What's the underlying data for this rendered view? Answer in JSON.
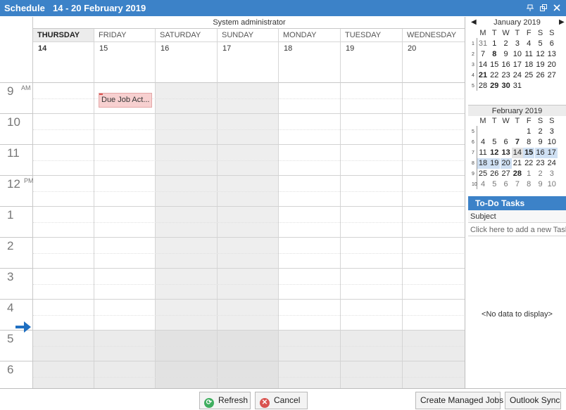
{
  "window": {
    "title": "Schedule",
    "date_range": "14 - 20 February 2019",
    "controls": [
      "pin",
      "restore",
      "close"
    ]
  },
  "resource": "System administrator",
  "days": [
    {
      "name": "THURSDAY",
      "date": "14",
      "today": true
    },
    {
      "name": "FRIDAY",
      "date": "15"
    },
    {
      "name": "SATURDAY",
      "date": "16",
      "weekend": true
    },
    {
      "name": "SUNDAY",
      "date": "17",
      "weekend": true
    },
    {
      "name": "MONDAY",
      "date": "18"
    },
    {
      "name": "TUESDAY",
      "date": "19"
    },
    {
      "name": "WEDNESDAY",
      "date": "20"
    }
  ],
  "hours": [
    {
      "h": "9",
      "ampm": "AM"
    },
    {
      "h": "10",
      "ampm": ""
    },
    {
      "h": "11",
      "ampm": ""
    },
    {
      "h": "12",
      "ampm": "PM"
    },
    {
      "h": "1",
      "ampm": ""
    },
    {
      "h": "2",
      "ampm": ""
    },
    {
      "h": "3",
      "ampm": ""
    },
    {
      "h": "4",
      "ampm": ""
    },
    {
      "h": "5",
      "ampm": ""
    },
    {
      "h": "6",
      "ampm": ""
    }
  ],
  "appointment": {
    "label": "Due Job Act...",
    "day": "FRIDAY",
    "hour": "9 AM"
  },
  "mini_calendars": [
    {
      "title": "January 2019",
      "dow": [
        "M",
        "T",
        "W",
        "T",
        "F",
        "S",
        "S"
      ],
      "weeks": [
        {
          "wk": "1",
          "days": [
            {
              "d": "31",
              "o": true
            },
            {
              "d": "1"
            },
            {
              "d": "2"
            },
            {
              "d": "3"
            },
            {
              "d": "4"
            },
            {
              "d": "5"
            },
            {
              "d": "6"
            }
          ]
        },
        {
          "wk": "2",
          "days": [
            {
              "d": "7"
            },
            {
              "d": "8",
              "b": true
            },
            {
              "d": "9"
            },
            {
              "d": "10"
            },
            {
              "d": "11"
            },
            {
              "d": "12"
            },
            {
              "d": "13"
            }
          ]
        },
        {
          "wk": "3",
          "days": [
            {
              "d": "14"
            },
            {
              "d": "15"
            },
            {
              "d": "16"
            },
            {
              "d": "17"
            },
            {
              "d": "18"
            },
            {
              "d": "19"
            },
            {
              "d": "20"
            }
          ]
        },
        {
          "wk": "4",
          "days": [
            {
              "d": "21",
              "b": true
            },
            {
              "d": "22"
            },
            {
              "d": "23"
            },
            {
              "d": "24"
            },
            {
              "d": "25"
            },
            {
              "d": "26"
            },
            {
              "d": "27"
            }
          ]
        },
        {
          "wk": "5",
          "days": [
            {
              "d": "28"
            },
            {
              "d": "29",
              "b": true
            },
            {
              "d": "30",
              "b": true
            },
            {
              "d": "31"
            }
          ]
        }
      ]
    },
    {
      "title": "February 2019",
      "dow": [
        "M",
        "T",
        "W",
        "T",
        "F",
        "S",
        "S"
      ],
      "weeks": [
        {
          "wk": "5",
          "days": [
            {
              "d": ""
            },
            {
              "d": ""
            },
            {
              "d": ""
            },
            {
              "d": ""
            },
            {
              "d": "1"
            },
            {
              "d": "2"
            },
            {
              "d": "3"
            }
          ]
        },
        {
          "wk": "6",
          "days": [
            {
              "d": "4"
            },
            {
              "d": "5"
            },
            {
              "d": "6"
            },
            {
              "d": "7",
              "b": true
            },
            {
              "d": "8"
            },
            {
              "d": "9"
            },
            {
              "d": "10"
            }
          ]
        },
        {
          "wk": "7",
          "days": [
            {
              "d": "11"
            },
            {
              "d": "12",
              "b": true
            },
            {
              "d": "13",
              "b": true
            },
            {
              "d": "14",
              "t": true
            },
            {
              "d": "15",
              "b": true,
              "s": true
            },
            {
              "d": "16",
              "s": true
            },
            {
              "d": "17",
              "s": true
            }
          ]
        },
        {
          "wk": "8",
          "days": [
            {
              "d": "18",
              "s": true
            },
            {
              "d": "19",
              "s": true
            },
            {
              "d": "20",
              "s": true
            },
            {
              "d": "21"
            },
            {
              "d": "22"
            },
            {
              "d": "23"
            },
            {
              "d": "24"
            }
          ]
        },
        {
          "wk": "9",
          "days": [
            {
              "d": "25"
            },
            {
              "d": "26"
            },
            {
              "d": "27"
            },
            {
              "d": "28",
              "b": true
            },
            {
              "d": "1",
              "o": true
            },
            {
              "d": "2",
              "o": true
            },
            {
              "d": "3",
              "o": true
            }
          ]
        },
        {
          "wk": "10",
          "days": [
            {
              "d": "4",
              "o": true
            },
            {
              "d": "5",
              "o": true
            },
            {
              "d": "6",
              "o": true
            },
            {
              "d": "7",
              "o": true
            },
            {
              "d": "8",
              "o": true
            },
            {
              "d": "9",
              "o": true
            },
            {
              "d": "10",
              "o": true
            }
          ]
        }
      ]
    }
  ],
  "todo": {
    "title": "To-Do Tasks",
    "column": "Subject",
    "add_placeholder": "Click here to add a new Task",
    "empty": "<No data to display>"
  },
  "buttons": {
    "refresh": "Refresh",
    "cancel": "Cancel",
    "create_jobs": "Create Managed Jobs",
    "outlook_sync": "Outlook Sync"
  },
  "colors": {
    "accent": "#3c82c8",
    "weekend": "#eeeeee",
    "appointment": "#f7d0d0",
    "selected": "#cfe0f3"
  }
}
